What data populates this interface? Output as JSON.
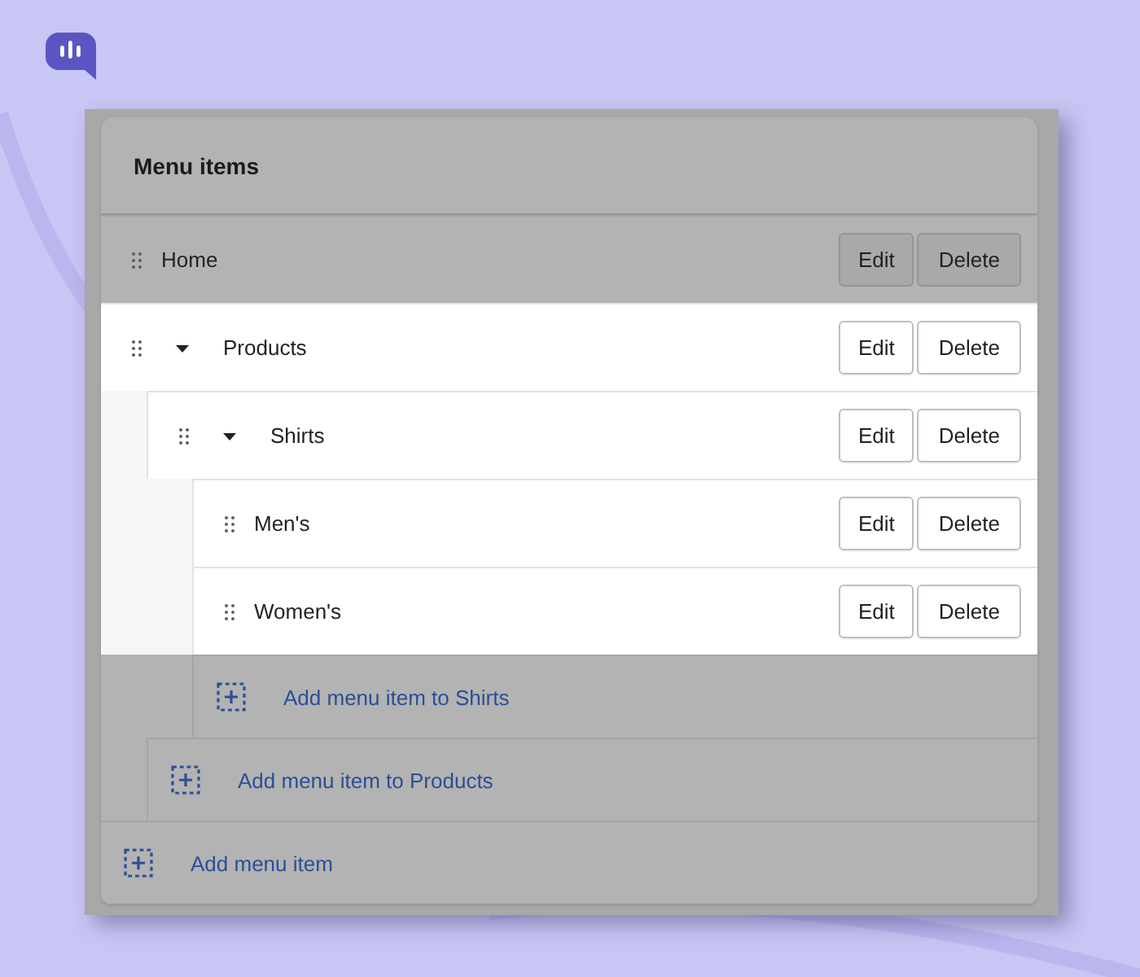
{
  "card": {
    "title": "Menu items"
  },
  "items": [
    {
      "label": "Home",
      "highlighted": false,
      "edit": "Edit",
      "delete": "Delete"
    },
    {
      "label": "Products",
      "highlighted": true,
      "expanded": true,
      "edit": "Edit",
      "delete": "Delete",
      "add_label": "Add menu item to Products",
      "children": [
        {
          "label": "Shirts",
          "expanded": true,
          "edit": "Edit",
          "delete": "Delete",
          "add_label": "Add menu item to Shirts",
          "children": [
            {
              "label": "Men's",
              "edit": "Edit",
              "delete": "Delete"
            },
            {
              "label": "Women's",
              "edit": "Edit",
              "delete": "Delete"
            }
          ]
        }
      ]
    }
  ],
  "add_label": "Add menu item"
}
